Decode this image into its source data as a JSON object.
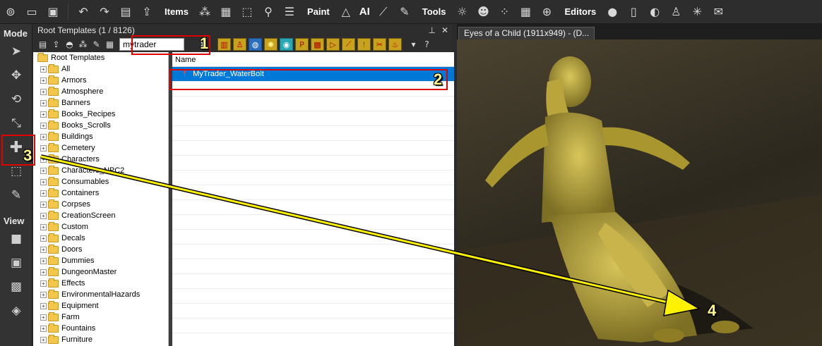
{
  "toolbar": {
    "items_label": "Items",
    "paint_label": "Paint",
    "ai_label": "AI",
    "tools_label": "Tools",
    "editors_label": "Editors"
  },
  "mode_bar": {
    "mode_header": "Mode",
    "view_header": "View",
    "mode_icons": [
      "select-icon",
      "move-icon",
      "rotate-icon",
      "scale-icon",
      "add-object-icon",
      "snap-icon",
      "edit-icon"
    ],
    "view_icons": [
      "solid-cube-icon",
      "wire-cube-icon",
      "texture-cube-icon",
      "lighting-cube-icon",
      "grid-cube-icon"
    ]
  },
  "root_templates": {
    "title": "Root Templates (1 / 8126)",
    "search_value": "mytrader",
    "column_name": "Name",
    "root_node": "Root Templates",
    "tree": [
      "All",
      "Armors",
      "Atmosphere",
      "Banners",
      "Books_Recipes",
      "Books_Scrolls",
      "Buildings",
      "Cemetery",
      "Characters",
      "Characters_NPC2",
      "Consumables",
      "Containers",
      "Corpses",
      "CreationScreen",
      "Custom",
      "Decals",
      "Doors",
      "Dummies",
      "DungeonMaster",
      "Effects",
      "EnvironmentalHazards",
      "Equipment",
      "Farm",
      "Fountains",
      "Furniture"
    ],
    "results": [
      "MyTrader_WaterBolt"
    ],
    "filter_icons": [
      "items-filter-icon",
      "characters-filter-icon",
      "atmosphere-filter-icon",
      "lights-filter-icon",
      "trigger-filter-icon",
      "projectile-filter-icon",
      "tile-filter-icon",
      "decal-filter-icon",
      "spline-filter-icon",
      "level-filter-icon",
      "surface-filter-icon",
      "fire-filter-icon"
    ]
  },
  "viewport": {
    "tab_title": "Eyes of a Child (1911x949) - (D..."
  },
  "annotations": {
    "callout_1": "1",
    "callout_2": "2",
    "callout_3": "3",
    "callout_4": "4",
    "highlight_color": "#e00000",
    "arrow_color": "#fff200",
    "selection_color": "#0078d7"
  }
}
